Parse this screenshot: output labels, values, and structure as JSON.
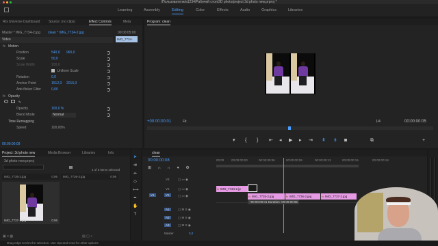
{
  "title": "/Пользователи/a1234/Рабочий стол/3D photo/project 3d photo new.prproj *",
  "workspace_tabs": [
    "Learning",
    "Assembly",
    "Editing",
    "Color",
    "Effects",
    "Audio",
    "Graphics",
    "Libraries"
  ],
  "active_workspace": "Editing",
  "source_panel": {
    "tabs": [
      "RG Universe Dashboard",
      "Source: (no clips)",
      "Effect Controls",
      "Meta"
    ],
    "active_tab": "Effect Controls",
    "master_label": "Master * IMG_7734-2.jpg",
    "clip_label": "clean * IMG_7734-2.jpg",
    "timecode_mini": "00:00:05:00",
    "mini_clip": "IMG_7734-2.jpg",
    "video_header": "Video",
    "motion": "Motion",
    "position_label": "Position",
    "position_x": "540,0",
    "position_y": "960,0",
    "scale_label": "Scale",
    "scale_value": "50,0",
    "scale_width_label": "Scale Width",
    "scale_width_value": "100,0",
    "uniform_scale": "Uniform Scale",
    "rotation_label": "Rotation",
    "rotation_value": "0,0",
    "anchor_label": "Anchor Point",
    "anchor_x": "1512,0",
    "anchor_y": "2016,0",
    "flicker_label": "Anti-flicker Filter",
    "flicker_value": "0,00",
    "opacity": "Opacity",
    "opacity_label": "Opacity",
    "opacity_value": "100,0 %",
    "blend_label": "Blend Mode",
    "blend_value": "Normal",
    "time_remap": "Time Remapping",
    "speed_label": "Speed",
    "speed_value": "100,00%",
    "bottom_timecode": "00:00:00:09"
  },
  "program_panel": {
    "title": "Program: clean",
    "timecode": "+00:00:00:01",
    "fit": "Fit",
    "page": "1/4",
    "duration": "00:00:00:05"
  },
  "project_panel": {
    "tabs": [
      "Project: 3d photo new",
      "Media Browser",
      "Libraries",
      "Info"
    ],
    "active_tab": "Project: 3d photo new",
    "project_file": "3d photo new.prproj",
    "items_selected": "4 of 5 items selected",
    "items": [
      {
        "name": "IMG_7735-2.jpg",
        "duration": "0:06"
      },
      {
        "name": "IMG_7736-2.jpg",
        "duration": "0:06"
      },
      {
        "name": "IMG_7737-2.jpg",
        "duration": "0:06"
      }
    ]
  },
  "timeline": {
    "sequence": "clean",
    "timecode": "00:00:00:08",
    "ruler": [
      "00:00",
      "00:00:00:03",
      "00:00:00:06",
      "00:00:00:09",
      "00:00:00:12",
      "00:00:00:15",
      "00:00:00:18"
    ],
    "tracks": [
      "V3",
      "V2",
      "V1",
      "A1",
      "A2",
      "A3"
    ],
    "source_patch": [
      "V1",
      "A1"
    ],
    "master_label": "Master",
    "master_value": "0,0",
    "clips_v2": [
      "IMG_7734-2.jp"
    ],
    "clips_v1": [
      "IMG_7735-2.jpg",
      "IMG_7736-2.jpg",
      "IMG_7737-2.jpg"
    ],
    "tooltip": "+00:00:00:01 Duration: 00:00:00:05"
  },
  "status_bar": "Drag edge to trim the selection. Use Opt and Cmd for other options",
  "colors": {
    "accent": "#4a9eff",
    "clip_pink": "#e59ae3",
    "panel": "#232323",
    "window_red": "#ff5f57",
    "window_yellow": "#febc2e",
    "window_green": "#28c840"
  }
}
